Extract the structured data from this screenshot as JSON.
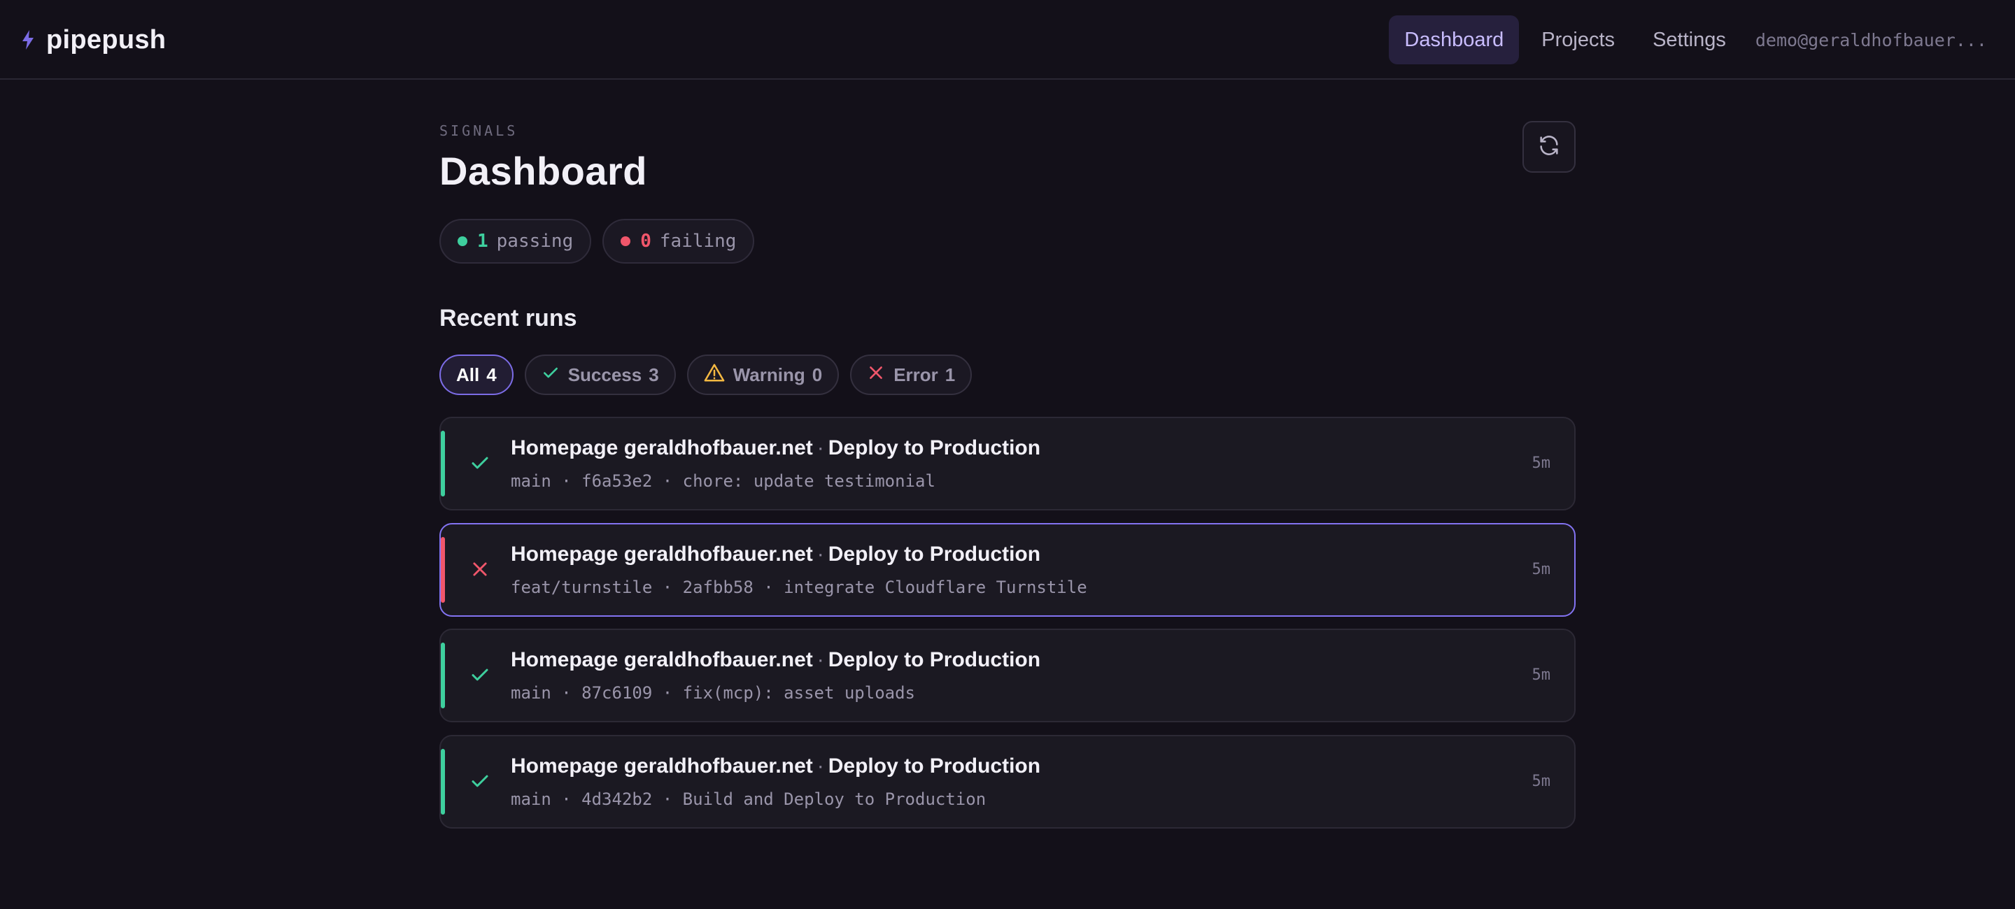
{
  "app": {
    "name": "pipepush"
  },
  "nav": {
    "items": [
      {
        "label": "Dashboard",
        "active": true
      },
      {
        "label": "Projects",
        "active": false
      },
      {
        "label": "Settings",
        "active": false
      }
    ],
    "user": "demo@geraldhofbauer..."
  },
  "page": {
    "eyebrow": "SIGNALS",
    "title": "Dashboard"
  },
  "stats": {
    "passing": {
      "count": "1",
      "label": "passing",
      "color": "#3ecf9e"
    },
    "failing": {
      "count": "0",
      "label": "failing",
      "color": "#f0566b"
    }
  },
  "recent": {
    "title": "Recent runs",
    "filters": [
      {
        "label": "All",
        "count": "4",
        "icon": "",
        "active": true
      },
      {
        "label": "Success",
        "count": "3",
        "icon": "check-icon",
        "active": false
      },
      {
        "label": "Warning",
        "count": "0",
        "icon": "warning-icon",
        "active": false
      },
      {
        "label": "Error",
        "count": "1",
        "icon": "x-icon",
        "active": false
      }
    ],
    "runs": [
      {
        "status": "success",
        "icon": "check-icon",
        "project": "Homepage geraldhofbauer.net",
        "sep": "·",
        "workflow": "Deploy to Production",
        "branch": "main",
        "commit": "f6a53e2",
        "message": "chore: update testimonial",
        "meta_sep": "·",
        "age": "5m"
      },
      {
        "status": "error",
        "icon": "x-icon",
        "project": "Homepage geraldhofbauer.net",
        "sep": "·",
        "workflow": "Deploy to Production",
        "branch": "feat/turnstile",
        "commit": "2afbb58",
        "message": "integrate Cloudflare Turnstile",
        "meta_sep": "·",
        "age": "5m"
      },
      {
        "status": "success",
        "icon": "check-icon",
        "project": "Homepage geraldhofbauer.net",
        "sep": "·",
        "workflow": "Deploy to Production",
        "branch": "main",
        "commit": "87c6109",
        "message": "fix(mcp): asset uploads",
        "meta_sep": "·",
        "age": "5m"
      },
      {
        "status": "success",
        "icon": "check-icon",
        "project": "Homepage geraldhofbauer.net",
        "sep": "·",
        "workflow": "Deploy to Production",
        "branch": "main",
        "commit": "4d342b2",
        "message": "Build and Deploy to Production",
        "meta_sep": "·",
        "age": "5m"
      }
    ]
  },
  "colors": {
    "accent": "#8373f2",
    "success": "#3ecf9e",
    "error": "#f0566b",
    "warning": "#f5b942"
  }
}
